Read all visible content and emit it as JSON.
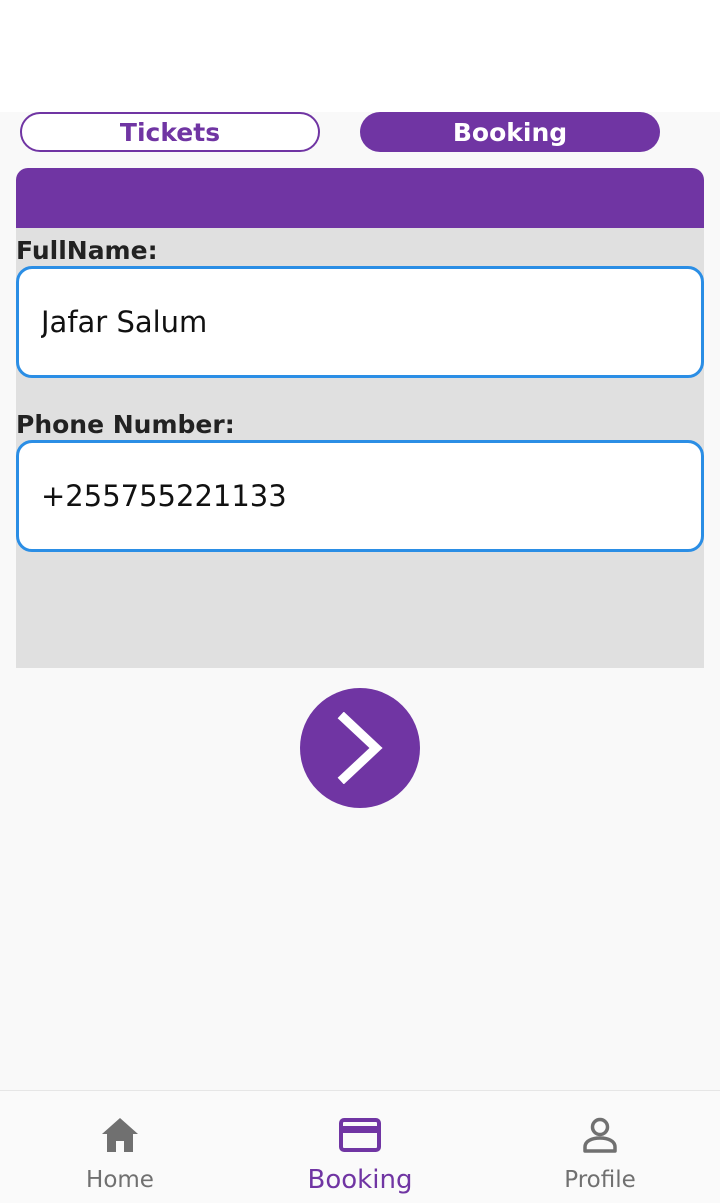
{
  "tabs": {
    "tickets_label": "Tickets",
    "booking_label": "Booking"
  },
  "form": {
    "fullname_label": "FullName:",
    "fullname_value": "Jafar Salum",
    "phone_label": "Phone Number:",
    "phone_value": "+255755221133",
    "next_icon": "chevron-right-icon"
  },
  "bottom_nav": {
    "items": [
      {
        "label": "Home",
        "icon": "home-icon",
        "active": false
      },
      {
        "label": "Booking",
        "icon": "credit-card-icon",
        "active": true
      },
      {
        "label": "Profile",
        "icon": "person-icon",
        "active": false
      }
    ]
  },
  "colors": {
    "primary": "#7035a3",
    "input_border": "#2b8ee5",
    "form_background": "#e0e0e0",
    "inactive_nav": "#707070"
  }
}
